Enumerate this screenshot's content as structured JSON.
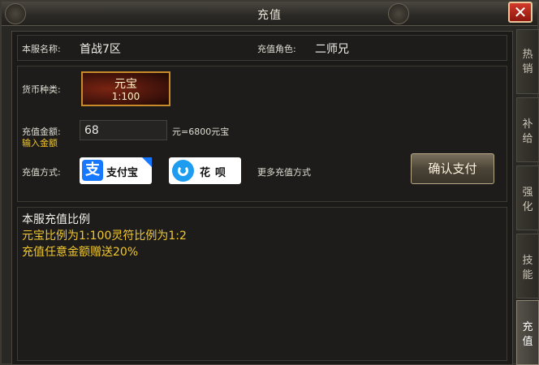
{
  "window": {
    "title": "充值"
  },
  "server": {
    "label": "本服名称:",
    "value": "首战7区"
  },
  "role": {
    "label": "充值角色:",
    "value": "二师兄"
  },
  "currency": {
    "label": "货币种类:",
    "tile_name": "元宝",
    "tile_rate": "1:100"
  },
  "amount": {
    "label": "充值金额:",
    "hint": "输入金额",
    "value": "68",
    "result": "元=6800元宝"
  },
  "payment": {
    "label": "充值方式:",
    "alipay_logo": "支",
    "alipay": "支付宝",
    "huabei": "花呗",
    "more": "更多充值方式",
    "confirm": "确认支付"
  },
  "ratio": {
    "title": "本服充值比例",
    "line1": "元宝比例为1:100灵符比例为1:2",
    "line2": "充值任意金额赠送20%"
  },
  "tabs": [
    {
      "label": "热销",
      "active": false
    },
    {
      "label": "补给",
      "active": false
    },
    {
      "label": "强化",
      "active": false
    },
    {
      "label": "技能",
      "active": false
    },
    {
      "label": "充值",
      "active": true
    }
  ],
  "colors": {
    "accent": "#f3c82d",
    "close": "#c8281c",
    "alipay": "#1677ff"
  }
}
